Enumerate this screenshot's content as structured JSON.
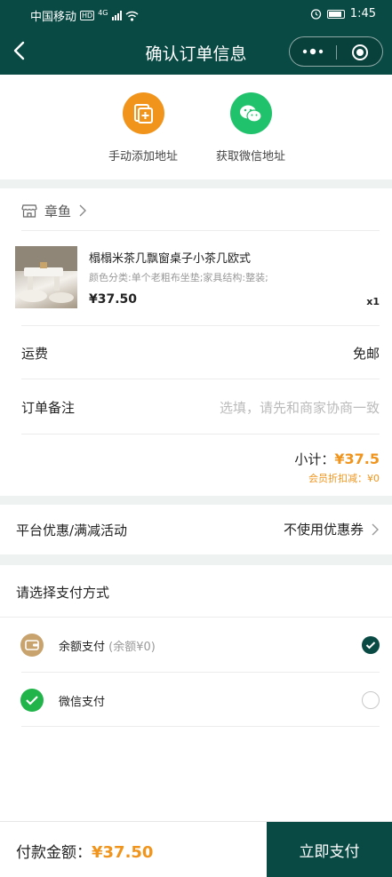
{
  "status_bar": {
    "carrier": "中国移动",
    "net_badge": "HD",
    "signal_type": "4G",
    "time": "1:45",
    "icons": [
      "alarm-icon",
      "battery-icon",
      "wifi-icon",
      "signal-icon"
    ]
  },
  "nav": {
    "title": "确认订单信息",
    "icons": [
      "back-icon",
      "more-icon",
      "close-mini-program-icon"
    ]
  },
  "address": {
    "manual_label": "手动添加地址",
    "wechat_label": "获取微信地址",
    "icons": [
      "add-address-icon",
      "wechat-icon"
    ],
    "colors": {
      "manual": "#f0941c",
      "wechat": "#20c36b"
    }
  },
  "shop": {
    "name": "章鱼",
    "icons": [
      "store-icon",
      "chevron-right-icon"
    ],
    "product": {
      "name": "榻榻米茶几飘窗桌子小茶几欧式",
      "spec": "颜色分类:单个老粗布坐垫;家具结构:整装;",
      "price": "¥37.50",
      "qty": "x1"
    },
    "shipping_label": "运费",
    "shipping_value": "免邮",
    "note_label": "订单备注",
    "note_placeholder": "选填，请先和商家协商一致",
    "subtotal_label": "小计：",
    "subtotal_value": "¥37.5",
    "member_discount": "会员折扣减：¥0"
  },
  "promo": {
    "label": "平台优惠/满减活动",
    "value": "不使用优惠券"
  },
  "payment": {
    "title": "请选择支付方式",
    "options": [
      {
        "label": "余额支付",
        "note": "(余额¥0)",
        "selected": true,
        "icon": "wallet-icon"
      },
      {
        "label": "微信支付",
        "note": "",
        "selected": false,
        "icon": "wechat-pay-icon"
      }
    ]
  },
  "footer": {
    "total_label": "付款金额：",
    "total_value": "¥37.50",
    "pay_button": "立即支付"
  },
  "colors": {
    "brand": "#0a4a44",
    "price": "#f0941c",
    "page_gap": "#eef2f1"
  }
}
